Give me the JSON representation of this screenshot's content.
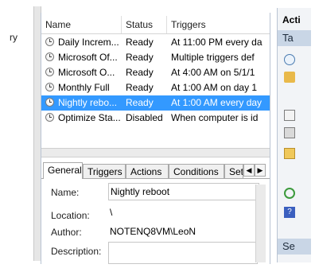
{
  "left_pane": {
    "text": "ry"
  },
  "columns": {
    "name": "Name",
    "status": "Status",
    "triggers": "Triggers"
  },
  "tasks": [
    {
      "name": "Daily Increm...",
      "status": "Ready",
      "triggers": "At 11:00 PM every da"
    },
    {
      "name": "Microsoft Of...",
      "status": "Ready",
      "triggers": "Multiple triggers def"
    },
    {
      "name": "Microsoft O...",
      "status": "Ready",
      "triggers": "At 4:00 AM on 5/1/1"
    },
    {
      "name": "Monthly Full",
      "status": "Ready",
      "triggers": "At 1:00 AM  on day 1"
    },
    {
      "name": "Nightly rebo...",
      "status": "Ready",
      "triggers": "At 1:00 AM every day"
    },
    {
      "name": "Optimize Sta...",
      "status": "Disabled",
      "triggers": "When computer is id"
    }
  ],
  "selected_task_index": 4,
  "tabs": [
    "General",
    "Triggers",
    "Actions",
    "Conditions",
    "Set"
  ],
  "active_tab": "General",
  "general": {
    "name_label": "Name:",
    "name_value": "Nightly reboot",
    "location_label": "Location:",
    "location_value": "\\",
    "author_label": "Author:",
    "author_value": "NOTENQ8VM\\LeoN",
    "description_label": "Description:",
    "description_value": ""
  },
  "actions_pane": {
    "title": "Acti",
    "section1": "Ta",
    "section2": "Se"
  },
  "colors": {
    "selection": "#3399ff",
    "accent_panel": "#c9d6e6"
  }
}
